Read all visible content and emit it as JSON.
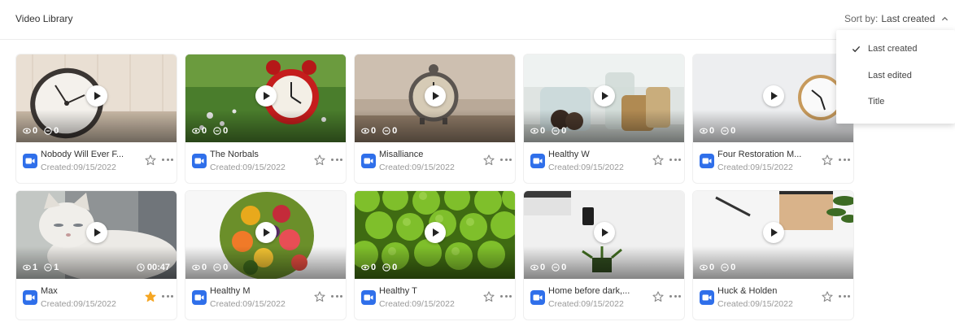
{
  "header": {
    "title": "Video Library",
    "sort_prefix": "Sort by:",
    "sort_value": "Last created"
  },
  "sort_menu": {
    "options": [
      {
        "label": "Last created",
        "selected": true
      },
      {
        "label": "Last edited",
        "selected": false
      },
      {
        "label": "Title",
        "selected": false
      }
    ]
  },
  "colors": {
    "accent": "#2f6fea",
    "focus_outline": "#2d6ae3",
    "favorite_star": "#f5a623"
  },
  "videos": [
    {
      "title": "Nobody Will Ever F...",
      "created": "Created:09/15/2022",
      "views": "0",
      "comments": "0",
      "duration": "",
      "favorite": false,
      "thumbnail": "wall-clock-on-wood"
    },
    {
      "title": "The Norbals",
      "created": "Created:09/15/2022",
      "views": "0",
      "comments": "0",
      "duration": "",
      "favorite": false,
      "thumbnail": "red-alarm-clock-grass"
    },
    {
      "title": "Misalliance",
      "created": "Created:09/15/2022",
      "views": "0",
      "comments": "0",
      "duration": "",
      "favorite": false,
      "thumbnail": "vintage-alarm-clock"
    },
    {
      "title": "Healthy W",
      "created": "Created:09/15/2022",
      "views": "0",
      "comments": "0",
      "duration": "",
      "favorite": false,
      "thumbnail": "jars-and-cookies"
    },
    {
      "title": "Four Restoration M...",
      "created": "Created:09/15/2022",
      "views": "0",
      "comments": "0",
      "duration": "",
      "favorite": false,
      "thumbnail": "white-wall-clock"
    },
    {
      "title": "Max",
      "created": "Created:09/15/2022",
      "views": "1",
      "comments": "1",
      "duration": "00:47",
      "favorite": true,
      "thumbnail": "white-cat"
    },
    {
      "title": "Healthy M",
      "created": "Created:09/15/2022",
      "views": "0",
      "comments": "0",
      "duration": "",
      "favorite": false,
      "thumbnail": "fruit-platter"
    },
    {
      "title": "Healthy T",
      "created": "Created:09/15/2022",
      "views": "0",
      "comments": "0",
      "duration": "",
      "favorite": false,
      "thumbnail": "green-apples"
    },
    {
      "title": "Home before dark,...",
      "created": "Created:09/15/2022",
      "views": "0",
      "comments": "0",
      "duration": "",
      "favorite": false,
      "thumbnail": "desk-with-laptop"
    },
    {
      "title": "Huck & Holden",
      "created": "Created:09/15/2022",
      "views": "0",
      "comments": "0",
      "duration": "",
      "favorite": false,
      "thumbnail": "desk-notebook-plant"
    }
  ]
}
